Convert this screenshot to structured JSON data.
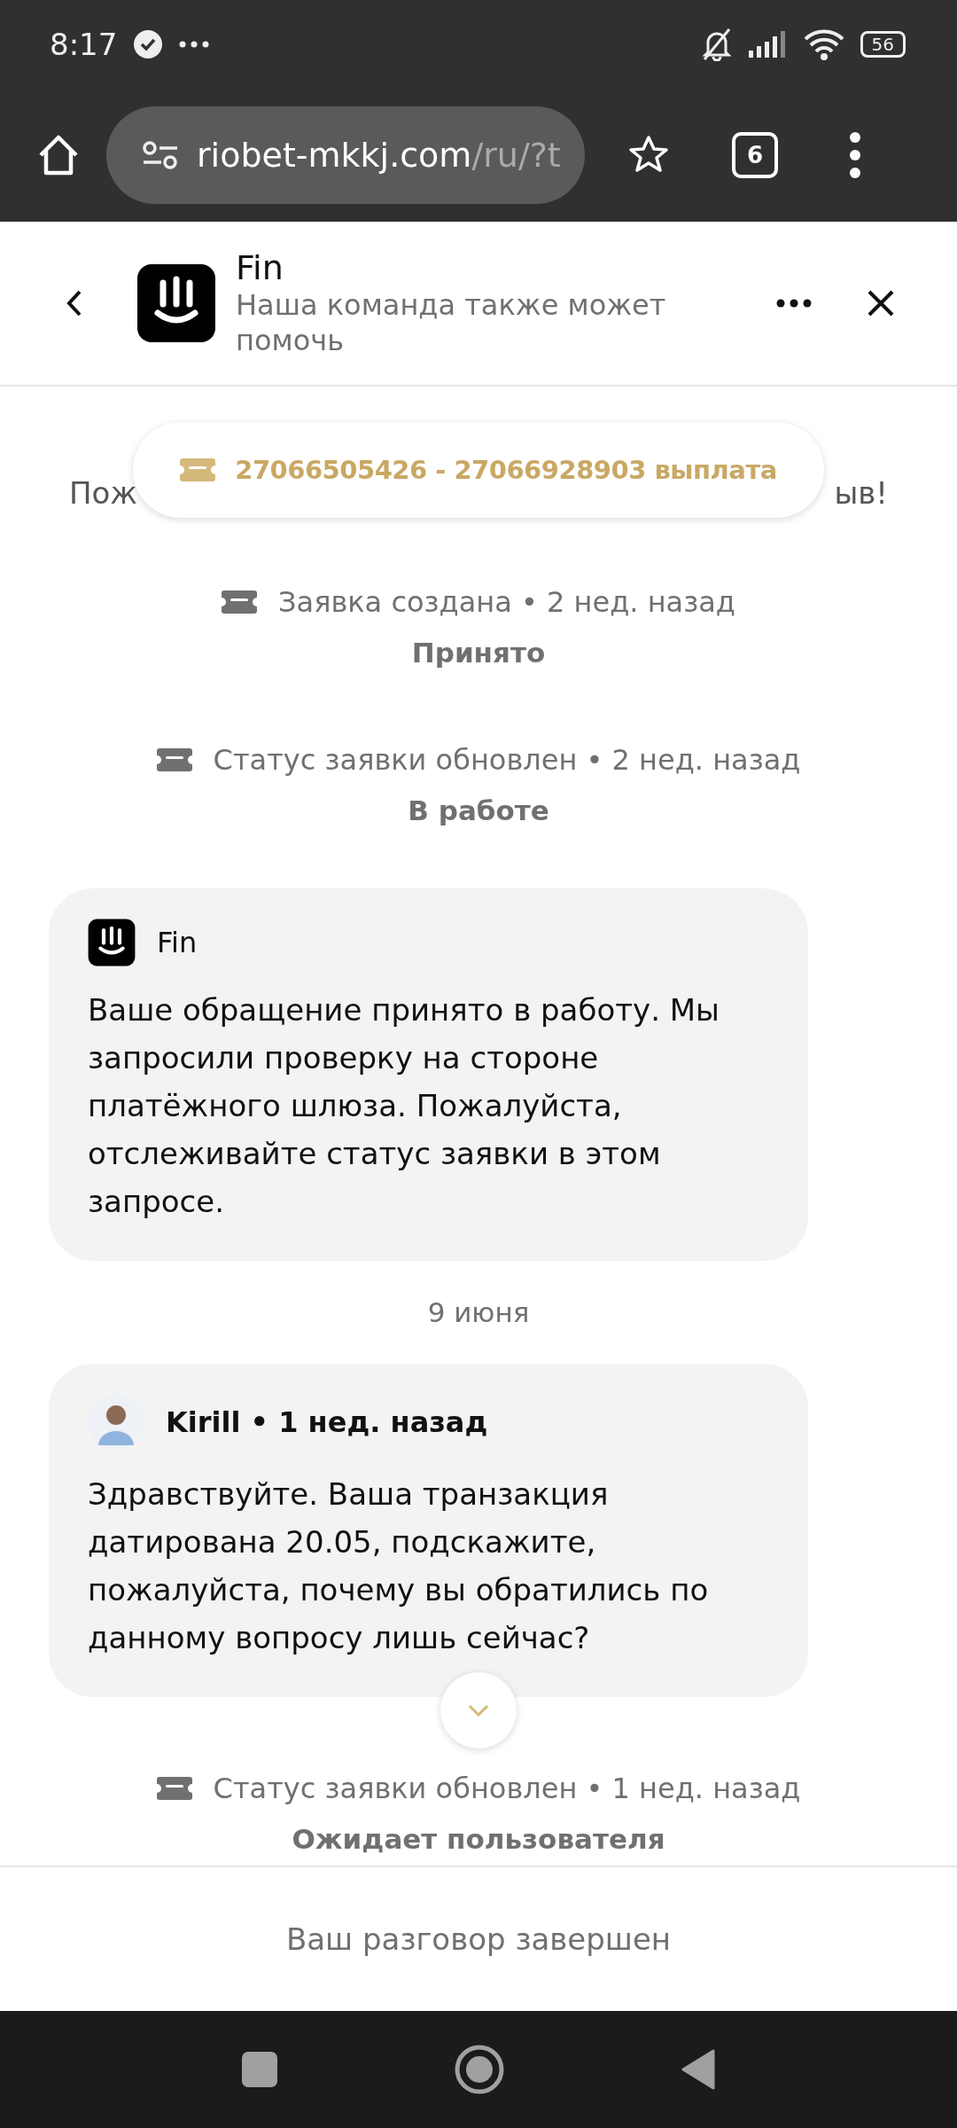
{
  "status_bar": {
    "time": "8:17",
    "battery": "56"
  },
  "browser": {
    "url_host": "riobet-mkkj.com",
    "url_path": "/ru/?t",
    "tab_count": "6"
  },
  "header": {
    "title": "Fin",
    "subtitle": "Наша команда также может помочь"
  },
  "ticket_pill": {
    "label": "27066505426 - 27066928903 выплата"
  },
  "covered_line": [
    "Пож",
    "ыв!"
  ],
  "feed": [
    {
      "kind": "status",
      "text": "Заявка создана • 2 нед. назад",
      "state": "Принято"
    },
    {
      "kind": "status",
      "text": "Статус заявки обновлен • 2 нед. назад",
      "state": "В работе"
    },
    {
      "kind": "message",
      "avatar": {
        "kind": "bot"
      },
      "author": "Fin",
      "text": "Ваше обращение принято в работу. Мы запросили проверку на стороне платёжного шлюза. Пожалуйста, отслеживайте статус заявки в этом запросе."
    },
    {
      "kind": "date",
      "text": "9 июня"
    },
    {
      "kind": "message",
      "avatar": {
        "kind": "person"
      },
      "author": "Kirill • 1 нед. назад",
      "text": "Здравствуйте. Ваша транзакция датирована 20.05, подскажите, пожалуйста, почему вы обратились по данному вопросу лишь сейчас?"
    },
    {
      "kind": "status",
      "text": "Статус заявки обновлен • 1 нед. назад",
      "state": "Ожидает пользователя"
    }
  ],
  "footer": {
    "text": "Ваш разговор завершен"
  }
}
